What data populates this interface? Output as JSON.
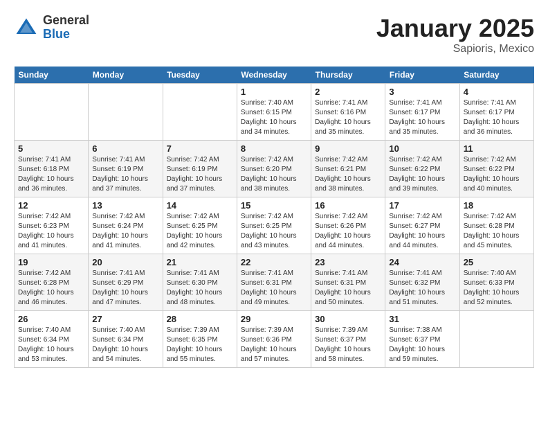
{
  "header": {
    "logo_general": "General",
    "logo_blue": "Blue",
    "month_title": "January 2025",
    "location": "Sapioris, Mexico"
  },
  "weekdays": [
    "Sunday",
    "Monday",
    "Tuesday",
    "Wednesday",
    "Thursday",
    "Friday",
    "Saturday"
  ],
  "weeks": [
    [
      {
        "day": "",
        "info": ""
      },
      {
        "day": "",
        "info": ""
      },
      {
        "day": "",
        "info": ""
      },
      {
        "day": "1",
        "info": "Sunrise: 7:40 AM\nSunset: 6:15 PM\nDaylight: 10 hours\nand 34 minutes."
      },
      {
        "day": "2",
        "info": "Sunrise: 7:41 AM\nSunset: 6:16 PM\nDaylight: 10 hours\nand 35 minutes."
      },
      {
        "day": "3",
        "info": "Sunrise: 7:41 AM\nSunset: 6:17 PM\nDaylight: 10 hours\nand 35 minutes."
      },
      {
        "day": "4",
        "info": "Sunrise: 7:41 AM\nSunset: 6:17 PM\nDaylight: 10 hours\nand 36 minutes."
      }
    ],
    [
      {
        "day": "5",
        "info": "Sunrise: 7:41 AM\nSunset: 6:18 PM\nDaylight: 10 hours\nand 36 minutes."
      },
      {
        "day": "6",
        "info": "Sunrise: 7:41 AM\nSunset: 6:19 PM\nDaylight: 10 hours\nand 37 minutes."
      },
      {
        "day": "7",
        "info": "Sunrise: 7:42 AM\nSunset: 6:19 PM\nDaylight: 10 hours\nand 37 minutes."
      },
      {
        "day": "8",
        "info": "Sunrise: 7:42 AM\nSunset: 6:20 PM\nDaylight: 10 hours\nand 38 minutes."
      },
      {
        "day": "9",
        "info": "Sunrise: 7:42 AM\nSunset: 6:21 PM\nDaylight: 10 hours\nand 38 minutes."
      },
      {
        "day": "10",
        "info": "Sunrise: 7:42 AM\nSunset: 6:22 PM\nDaylight: 10 hours\nand 39 minutes."
      },
      {
        "day": "11",
        "info": "Sunrise: 7:42 AM\nSunset: 6:22 PM\nDaylight: 10 hours\nand 40 minutes."
      }
    ],
    [
      {
        "day": "12",
        "info": "Sunrise: 7:42 AM\nSunset: 6:23 PM\nDaylight: 10 hours\nand 41 minutes."
      },
      {
        "day": "13",
        "info": "Sunrise: 7:42 AM\nSunset: 6:24 PM\nDaylight: 10 hours\nand 41 minutes."
      },
      {
        "day": "14",
        "info": "Sunrise: 7:42 AM\nSunset: 6:25 PM\nDaylight: 10 hours\nand 42 minutes."
      },
      {
        "day": "15",
        "info": "Sunrise: 7:42 AM\nSunset: 6:25 PM\nDaylight: 10 hours\nand 43 minutes."
      },
      {
        "day": "16",
        "info": "Sunrise: 7:42 AM\nSunset: 6:26 PM\nDaylight: 10 hours\nand 44 minutes."
      },
      {
        "day": "17",
        "info": "Sunrise: 7:42 AM\nSunset: 6:27 PM\nDaylight: 10 hours\nand 44 minutes."
      },
      {
        "day": "18",
        "info": "Sunrise: 7:42 AM\nSunset: 6:28 PM\nDaylight: 10 hours\nand 45 minutes."
      }
    ],
    [
      {
        "day": "19",
        "info": "Sunrise: 7:42 AM\nSunset: 6:28 PM\nDaylight: 10 hours\nand 46 minutes."
      },
      {
        "day": "20",
        "info": "Sunrise: 7:41 AM\nSunset: 6:29 PM\nDaylight: 10 hours\nand 47 minutes."
      },
      {
        "day": "21",
        "info": "Sunrise: 7:41 AM\nSunset: 6:30 PM\nDaylight: 10 hours\nand 48 minutes."
      },
      {
        "day": "22",
        "info": "Sunrise: 7:41 AM\nSunset: 6:31 PM\nDaylight: 10 hours\nand 49 minutes."
      },
      {
        "day": "23",
        "info": "Sunrise: 7:41 AM\nSunset: 6:31 PM\nDaylight: 10 hours\nand 50 minutes."
      },
      {
        "day": "24",
        "info": "Sunrise: 7:41 AM\nSunset: 6:32 PM\nDaylight: 10 hours\nand 51 minutes."
      },
      {
        "day": "25",
        "info": "Sunrise: 7:40 AM\nSunset: 6:33 PM\nDaylight: 10 hours\nand 52 minutes."
      }
    ],
    [
      {
        "day": "26",
        "info": "Sunrise: 7:40 AM\nSunset: 6:34 PM\nDaylight: 10 hours\nand 53 minutes."
      },
      {
        "day": "27",
        "info": "Sunrise: 7:40 AM\nSunset: 6:34 PM\nDaylight: 10 hours\nand 54 minutes."
      },
      {
        "day": "28",
        "info": "Sunrise: 7:39 AM\nSunset: 6:35 PM\nDaylight: 10 hours\nand 55 minutes."
      },
      {
        "day": "29",
        "info": "Sunrise: 7:39 AM\nSunset: 6:36 PM\nDaylight: 10 hours\nand 57 minutes."
      },
      {
        "day": "30",
        "info": "Sunrise: 7:39 AM\nSunset: 6:37 PM\nDaylight: 10 hours\nand 58 minutes."
      },
      {
        "day": "31",
        "info": "Sunrise: 7:38 AM\nSunset: 6:37 PM\nDaylight: 10 hours\nand 59 minutes."
      },
      {
        "day": "",
        "info": ""
      }
    ]
  ]
}
